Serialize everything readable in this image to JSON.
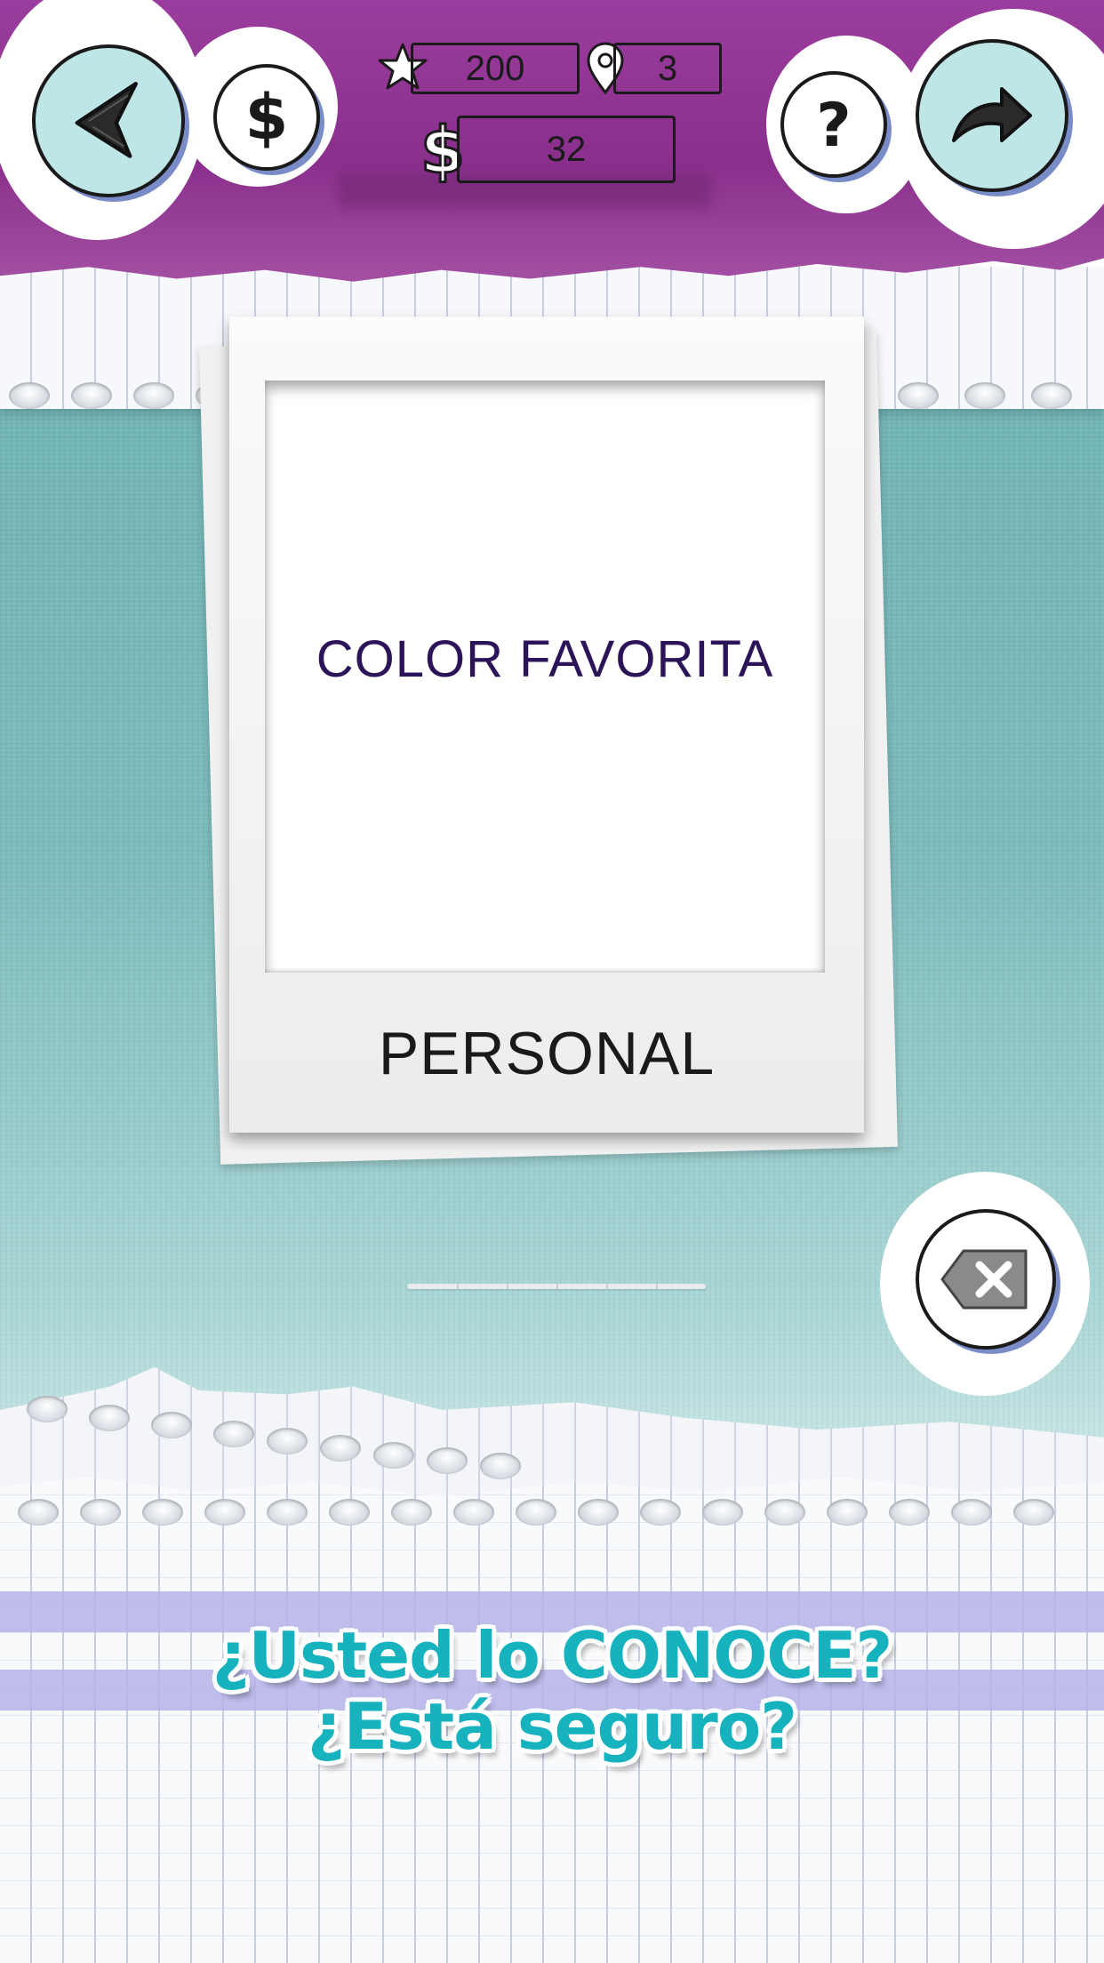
{
  "header": {
    "stars": "200",
    "location_count": "3",
    "coins": "32"
  },
  "card": {
    "prompt": "COLOR FAVORITA",
    "category": "PERSONAL"
  },
  "slogan": {
    "line1": "¿Usted lo CONOCE?",
    "line2": "¿Está seguro?"
  },
  "icons": {
    "back": "back-arrow-icon",
    "shop": "dollar-icon",
    "star": "star-icon",
    "location": "location-pin-icon",
    "coin": "dollar-icon",
    "help": "question-icon",
    "share": "share-arrow-icon",
    "delete": "backspace-icon"
  },
  "colors": {
    "header": "#9b3d9e",
    "background": "#7dbcbd",
    "card_text": "#2b1458",
    "slogan": "#16b2bd",
    "stripe": "#b4b2e8"
  }
}
